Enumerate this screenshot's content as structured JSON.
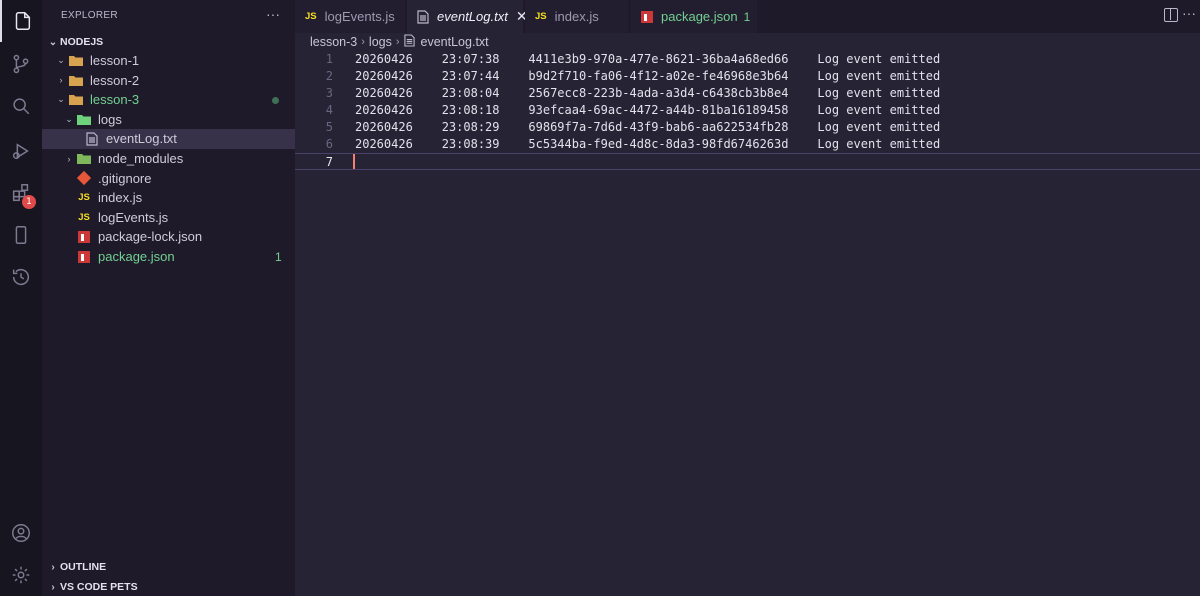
{
  "sidebar": {
    "title": "EXPLORER",
    "more": "···",
    "root": "NODEJS",
    "items": [
      {
        "label": "lesson-1"
      },
      {
        "label": "lesson-2"
      },
      {
        "label": "lesson-3"
      },
      {
        "label": "logs"
      },
      {
        "label": "eventLog.txt"
      },
      {
        "label": "node_modules"
      },
      {
        "label": ".gitignore"
      },
      {
        "label": "index.js"
      },
      {
        "label": "logEvents.js"
      },
      {
        "label": "package-lock.json"
      },
      {
        "label": "package.json",
        "count": "1"
      }
    ],
    "outline": "OUTLINE",
    "pets": "VS CODE PETS"
  },
  "activity": {
    "badge": "1"
  },
  "tabs": [
    {
      "label": "logEvents.js",
      "icon": "JS"
    },
    {
      "label": "eventLog.txt",
      "close": "✕"
    },
    {
      "label": "index.js",
      "icon": "JS"
    },
    {
      "label": "package.json",
      "count": "1"
    }
  ],
  "editor": {
    "more": "···",
    "breadcrumb": [
      "lesson-3",
      "logs",
      "eventLog.txt"
    ],
    "lines": [
      {
        "n": "1",
        "text": "20260426    23:07:38    4411e3b9-970a-477e-8621-36ba4a68ed66    Log event emitted"
      },
      {
        "n": "2",
        "text": "20260426    23:07:44    b9d2f710-fa06-4f12-a02e-fe46968e3b64    Log event emitted"
      },
      {
        "n": "3",
        "text": "20260426    23:08:04    2567ecc8-223b-4ada-a3d4-c6438cb3b8e4    Log event emitted"
      },
      {
        "n": "4",
        "text": "20260426    23:08:18    93efcaa4-69ac-4472-a44b-81ba16189458    Log event emitted"
      },
      {
        "n": "5",
        "text": "20260426    23:08:29    69869f7a-7d6d-43f9-bab6-aa622534fb28    Log event emitted"
      },
      {
        "n": "6",
        "text": "20260426    23:08:39    5c5344ba-f9ed-4d8c-8da3-98fd6746263d    Log event emitted"
      },
      {
        "n": "7",
        "text": ""
      }
    ]
  },
  "colors": {
    "accent": "#f97e72",
    "git_added": "#72d191",
    "background": "#262335"
  }
}
